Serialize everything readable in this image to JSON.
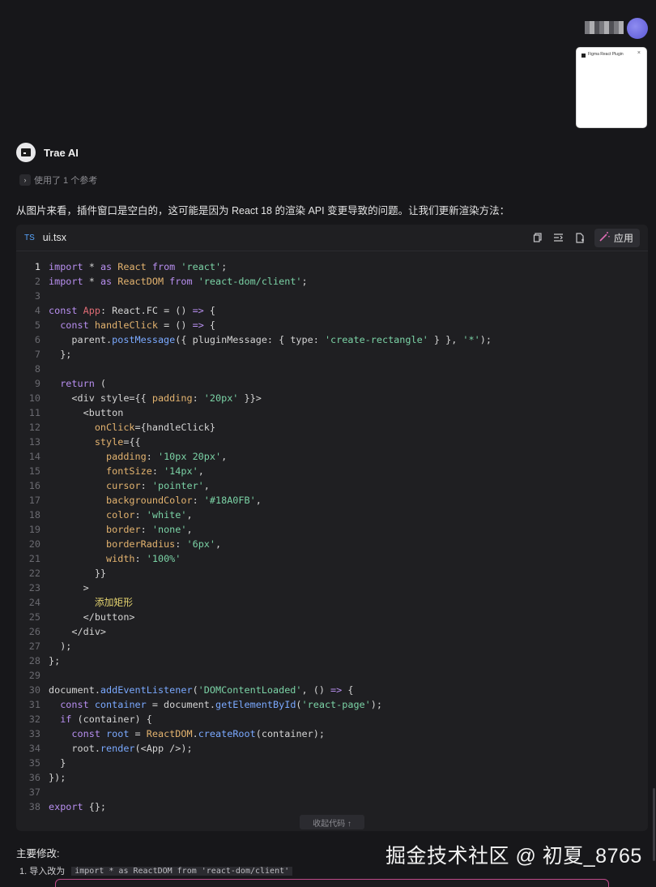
{
  "attachment": {
    "title": "Figma React Plugin",
    "close": "×"
  },
  "assistant": {
    "name": "Trae AI",
    "reference_text": "使用了 1 个参考"
  },
  "intro": "从图片来看，插件窗口是空白的，这可能是因为 React 18 的渲染 API 变更导致的问题。让我们更新渲染方法：",
  "code_card": {
    "lang_badge": "TS",
    "filename": "ui.tsx",
    "apply_label": "应用",
    "collapse_label": "收起代码 ↑",
    "active_line": 1,
    "lines": [
      [
        [
          "kw",
          "import "
        ],
        [
          "",
          "* "
        ],
        [
          "kw",
          "as "
        ],
        [
          "fn",
          "React "
        ],
        [
          "kw",
          "from "
        ],
        [
          "str",
          "'react'"
        ],
        [
          "",
          ";"
        ]
      ],
      [
        [
          "kw",
          "import "
        ],
        [
          "",
          "* "
        ],
        [
          "kw",
          "as "
        ],
        [
          "fn",
          "ReactDOM "
        ],
        [
          "kw",
          "from "
        ],
        [
          "str",
          "'react-dom/client'"
        ],
        [
          "",
          ";"
        ]
      ],
      [],
      [
        [
          "kw",
          "const "
        ],
        [
          "typ",
          "App"
        ],
        [
          "",
          ": React.FC = () "
        ],
        [
          "kw",
          "=>"
        ],
        [
          "",
          " {"
        ]
      ],
      [
        [
          "kw",
          "  const "
        ],
        [
          "fn",
          "handleClick"
        ],
        [
          "",
          " = () "
        ],
        [
          "kw",
          "=>"
        ],
        [
          "",
          " {"
        ]
      ],
      [
        [
          "",
          "    parent."
        ],
        [
          "var",
          "postMessage"
        ],
        [
          "",
          "({ pluginMessage: { type: "
        ],
        [
          "str",
          "'create-rectangle'"
        ],
        [
          "",
          " } }, "
        ],
        [
          "str",
          "'*'"
        ],
        [
          "",
          ");"
        ]
      ],
      [
        [
          "",
          "  };"
        ]
      ],
      [],
      [
        [
          "kw",
          "  return"
        ],
        [
          "",
          " ("
        ]
      ],
      [
        [
          "",
          "    <div style={{ "
        ],
        [
          "fn",
          "padding"
        ],
        [
          "",
          ": "
        ],
        [
          "str",
          "'20px'"
        ],
        [
          "",
          " }}>"
        ]
      ],
      [
        [
          "",
          "      <button"
        ]
      ],
      [
        [
          "fn",
          "        onClick"
        ],
        [
          "",
          "={handleClick}"
        ]
      ],
      [
        [
          "fn",
          "        style"
        ],
        [
          "",
          "={{"
        ]
      ],
      [
        [
          "fn",
          "          padding"
        ],
        [
          "",
          ": "
        ],
        [
          "str",
          "'10px 20px'"
        ],
        [
          "",
          ","
        ]
      ],
      [
        [
          "fn",
          "          fontSize"
        ],
        [
          "",
          ": "
        ],
        [
          "str",
          "'14px'"
        ],
        [
          "",
          ","
        ]
      ],
      [
        [
          "fn",
          "          cursor"
        ],
        [
          "",
          ": "
        ],
        [
          "str",
          "'pointer'"
        ],
        [
          "",
          ","
        ]
      ],
      [
        [
          "fn",
          "          backgroundColor"
        ],
        [
          "",
          ": "
        ],
        [
          "str",
          "'#18A0FB'"
        ],
        [
          "",
          ","
        ]
      ],
      [
        [
          "fn",
          "          color"
        ],
        [
          "",
          ": "
        ],
        [
          "str",
          "'white'"
        ],
        [
          "",
          ","
        ]
      ],
      [
        [
          "fn",
          "          border"
        ],
        [
          "",
          ": "
        ],
        [
          "str",
          "'none'"
        ],
        [
          "",
          ","
        ]
      ],
      [
        [
          "fn",
          "          borderRadius"
        ],
        [
          "",
          ": "
        ],
        [
          "str",
          "'6px'"
        ],
        [
          "",
          ","
        ]
      ],
      [
        [
          "fn",
          "          width"
        ],
        [
          "",
          ": "
        ],
        [
          "str",
          "'100%'"
        ]
      ],
      [
        [
          "",
          "        }}"
        ]
      ],
      [
        [
          "",
          "      >"
        ]
      ],
      [
        [
          "zh",
          "        添加矩形"
        ]
      ],
      [
        [
          "",
          "      </button>"
        ]
      ],
      [
        [
          "",
          "    </div>"
        ]
      ],
      [
        [
          "",
          "  );"
        ]
      ],
      [
        [
          "",
          "};"
        ]
      ],
      [],
      [
        [
          "",
          "document."
        ],
        [
          "var",
          "addEventListener"
        ],
        [
          "",
          "("
        ],
        [
          "str",
          "'DOMContentLoaded'"
        ],
        [
          "",
          ", () "
        ],
        [
          "kw",
          "=>"
        ],
        [
          "",
          " {"
        ]
      ],
      [
        [
          "kw",
          "  const "
        ],
        [
          "var",
          "container"
        ],
        [
          "",
          " = document."
        ],
        [
          "var",
          "getElementById"
        ],
        [
          "",
          "("
        ],
        [
          "str",
          "'react-page'"
        ],
        [
          "",
          ");"
        ]
      ],
      [
        [
          "kw",
          "  if"
        ],
        [
          "",
          " (container) {"
        ]
      ],
      [
        [
          "kw",
          "    const "
        ],
        [
          "var",
          "root"
        ],
        [
          "",
          " = "
        ],
        [
          "fn",
          "ReactDOM"
        ],
        [
          "",
          "."
        ],
        [
          "var",
          "createRoot"
        ],
        [
          "",
          "(container);"
        ]
      ],
      [
        [
          "",
          "    root."
        ],
        [
          "var",
          "render"
        ],
        [
          "",
          "(<App />);"
        ]
      ],
      [
        [
          "",
          "  }"
        ]
      ],
      [
        [
          "",
          "});"
        ]
      ],
      [],
      [
        [
          "kw",
          "export "
        ],
        [
          "",
          "{};"
        ]
      ]
    ]
  },
  "summary": {
    "heading": "主要修改:",
    "bullet": "1. 导入改为",
    "bullet_code": "import * as ReactDOM from 'react-dom/client'"
  },
  "watermark": "掘金技术社区 @ 初夏_8765",
  "colors": {
    "background": "#17171a",
    "card": "#1f1f22",
    "keyword": "#b88ff0",
    "string": "#7bd3a6",
    "accent": "#e06cb5"
  }
}
